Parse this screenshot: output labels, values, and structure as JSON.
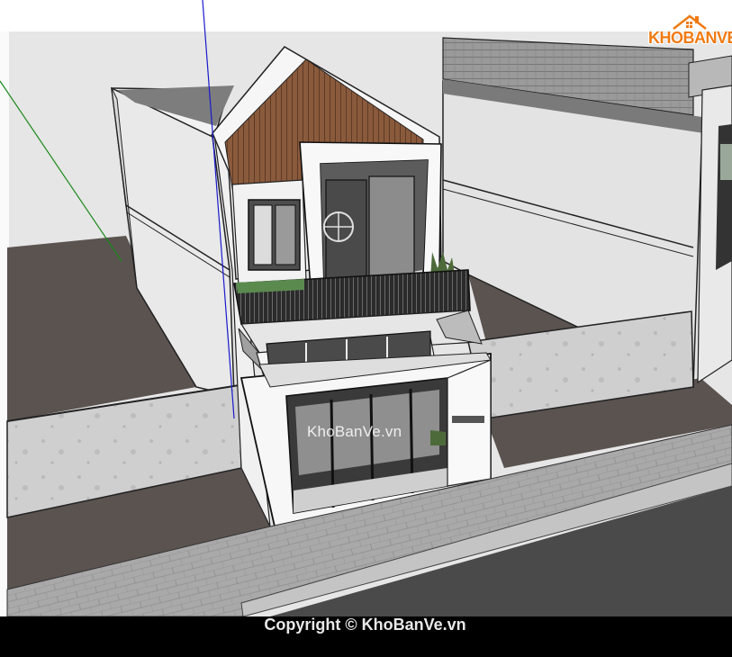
{
  "logo": {
    "text": "KHOBANVE",
    "house_color": "#f07a12"
  },
  "watermark": {
    "text": "KhoBanVe.vn"
  },
  "footer": {
    "copyright": "Copyright © KhoBanVe.vn"
  },
  "colors": {
    "wall_white": "#f4f4f4",
    "wall_shadow": "#d9d9d9",
    "ground_dark": "#5a5350",
    "wood": "#8a5a3c",
    "fence": "#c9c9c9",
    "road": "#4a4a4a",
    "sidewalk": "#a6a6a6",
    "axis_green": "#1a8a1a",
    "axis_blue": "#1a1acc"
  }
}
